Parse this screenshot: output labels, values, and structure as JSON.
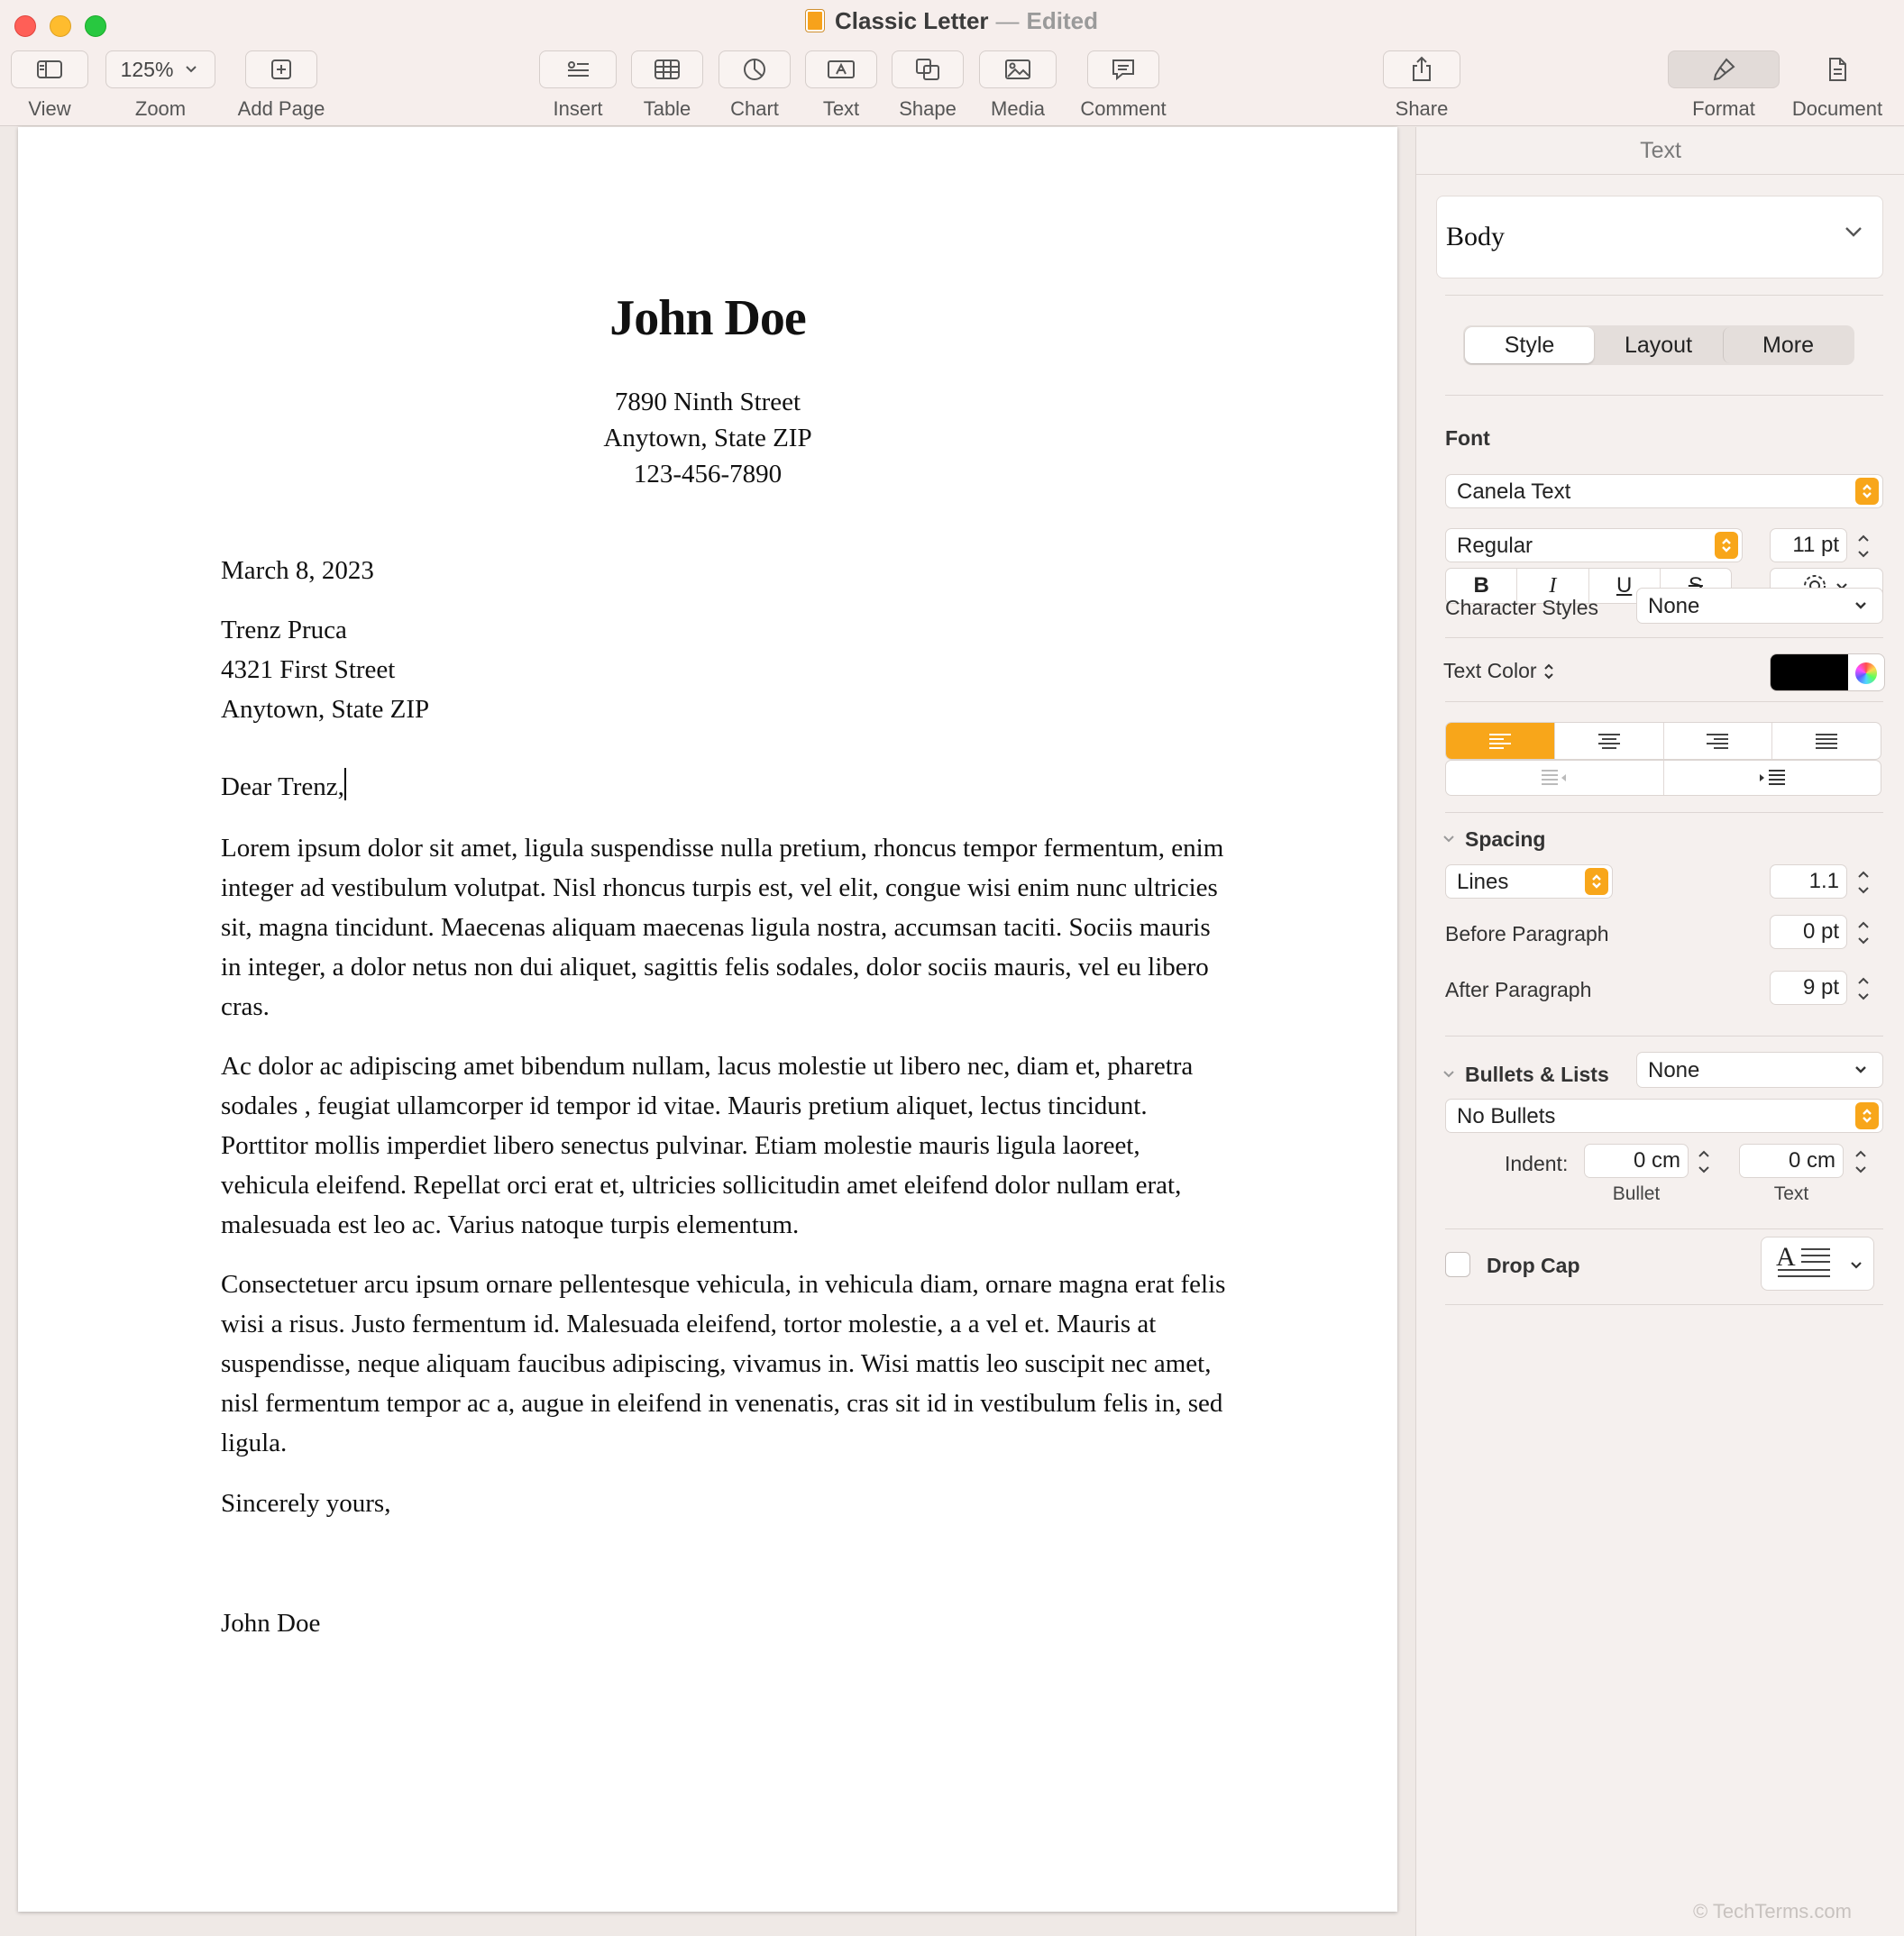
{
  "window": {
    "title": "Classic Letter",
    "dash": "—",
    "status": "Edited"
  },
  "toolbar": {
    "view": {
      "label": "View",
      "icon": "sidebar-icon"
    },
    "zoom": {
      "label": "Zoom",
      "value": "125%"
    },
    "add_page": {
      "label": "Add Page",
      "icon": "add-page-icon"
    },
    "insert": {
      "label": "Insert",
      "icon": "insert-icon"
    },
    "table": {
      "label": "Table",
      "icon": "table-icon"
    },
    "chart": {
      "label": "Chart",
      "icon": "chart-icon"
    },
    "text": {
      "label": "Text",
      "icon": "text-box-icon"
    },
    "shape": {
      "label": "Shape",
      "icon": "shape-icon"
    },
    "media": {
      "label": "Media",
      "icon": "media-icon"
    },
    "comment": {
      "label": "Comment",
      "icon": "comment-icon"
    },
    "share": {
      "label": "Share",
      "icon": "share-icon"
    },
    "format": {
      "label": "Format",
      "icon": "paintbrush-icon",
      "active": true
    },
    "document": {
      "label": "Document",
      "icon": "document-icon"
    }
  },
  "letter": {
    "sender_name": "John Doe",
    "sender_address": [
      "7890 Ninth Street",
      "Anytown, State ZIP",
      "123-456-7890"
    ],
    "date": "March 8, 2023",
    "recipient": [
      "Trenz Pruca",
      "4321 First Street",
      "Anytown, State ZIP"
    ],
    "salutation": "Dear Trenz,",
    "paragraphs": [
      "Lorem ipsum dolor sit amet, ligula suspendisse nulla pretium, rhoncus tempor fermentum, enim integer ad vestibulum volutpat. Nisl rhoncus turpis est, vel elit, congue wisi enim nunc ultricies sit, magna tincidunt. Maecenas aliquam maecenas ligula nostra, accumsan taciti. Sociis mauris in integer, a dolor netus non dui aliquet, sagittis felis sodales, dolor sociis mauris, vel eu libero cras.",
      "Ac dolor ac adipiscing amet bibendum nullam, lacus molestie ut libero nec, diam et, pharetra sodales , feugiat ullamcorper id tempor id vitae. Mauris pretium aliquet, lectus tincidunt. Porttitor mollis imperdiet libero senectus pulvinar. Etiam molestie mauris ligula laoreet, vehicula eleifend. Repellat orci erat et, ultricies sollicitudin amet eleifend dolor nullam erat, malesuada est leo ac. Varius natoque turpis elementum.",
      "Consectetuer arcu ipsum ornare pellentesque vehicula, in vehicula diam, ornare magna erat felis wisi a risus. Justo fermentum id. Malesuada eleifend, tortor molestie, a a vel et. Mauris at suspendisse, neque aliquam faucibus adipiscing, vivamus in. Wisi mattis leo suscipit nec amet, nisl fermentum tempor ac a, augue in eleifend in venenatis, cras sit id in vestibulum felis in, sed ligula."
    ],
    "closing": "Sincerely yours,",
    "signature": "John Doe"
  },
  "inspector": {
    "header": "Text",
    "paragraph_style": "Body",
    "tabs": [
      "Style",
      "Layout",
      "More"
    ],
    "active_tab": "Style",
    "font": {
      "title": "Font",
      "family": "Canela Text",
      "weight": "Regular",
      "size": "11 pt",
      "bold": "B",
      "italic": "I",
      "underline": "U",
      "strike": "S"
    },
    "character_styles": {
      "label": "Character Styles",
      "value": "None"
    },
    "text_color": {
      "label": "Text Color",
      "color": "#000000"
    },
    "alignment": {
      "selected": "left",
      "accent": "#f8a61a"
    },
    "spacing": {
      "title": "Spacing",
      "line_mode": "Lines",
      "line_value": "1.1",
      "before_label": "Before Paragraph",
      "before_value": "0 pt",
      "after_label": "After Paragraph",
      "after_value": "9 pt"
    },
    "bullets": {
      "title": "Bullets & Lists",
      "list_value": "None",
      "bullet_style": "No Bullets",
      "indent_label": "Indent:",
      "bullet_indent": "0 cm",
      "text_indent": "0 cm",
      "bullet_caption": "Bullet",
      "text_caption": "Text"
    },
    "drop_cap": {
      "label": "Drop Cap",
      "checked": false
    }
  },
  "watermark": "© TechTerms.com"
}
